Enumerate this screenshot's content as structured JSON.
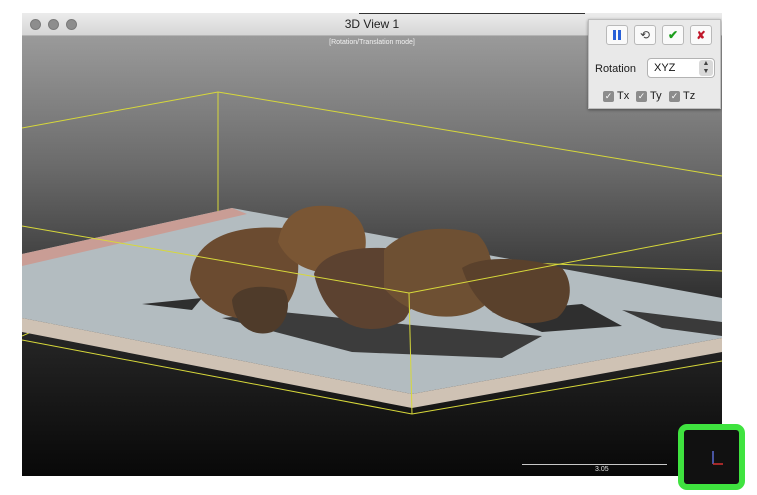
{
  "window": {
    "title": "3D View 1",
    "mode_label": "[Rotation/Translation mode]"
  },
  "panel": {
    "pause_icon": "pause-icon",
    "reset_icon": "reset-icon",
    "apply_icon": "checkmark-icon",
    "cancel_icon": "close-icon",
    "rotation_label": "Rotation",
    "rotation_value": "XYZ",
    "tx_label": "Tx",
    "ty_label": "Ty",
    "tz_label": "Tz",
    "tx_checked": true,
    "ty_checked": true,
    "tz_checked": true
  },
  "scale": {
    "label": "3.05"
  },
  "colors": {
    "highlight": "#3fe33f",
    "bbox": "#d7d83a",
    "apply": "#1d9e1d",
    "cancel": "#c0172a",
    "pause": "#2860d8"
  }
}
